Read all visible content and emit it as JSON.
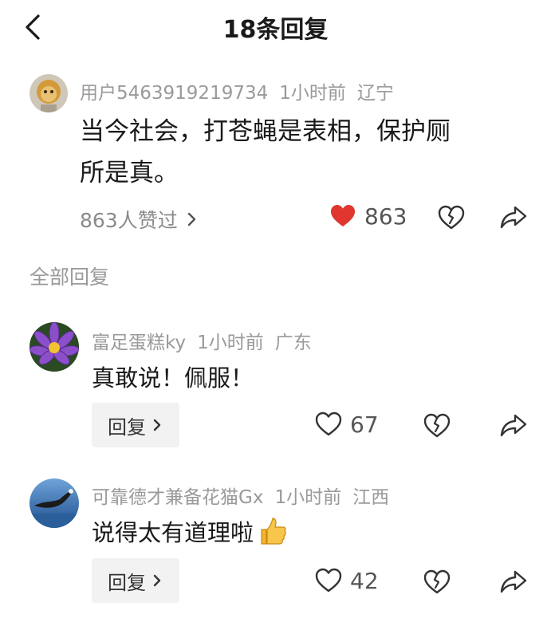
{
  "header": {
    "title": "18条回复"
  },
  "main_comment": {
    "user": "用户5463919219734",
    "time": "1小时前",
    "location": "辽宁",
    "text_line1": "当今社会，打苍蝇是表相，保护厕",
    "text_line2": "所是真。",
    "likers": "863人赞过",
    "like_count": "863",
    "liked": true
  },
  "section_label": "全部回复",
  "replies": [
    {
      "user": "富足蛋糕ky",
      "time": "1小时前",
      "location": "广东",
      "text": "真敢说！佩服！",
      "reply_label": "回复",
      "like_count": "67"
    },
    {
      "user": "可靠德才兼备花猫Gx",
      "time": "1小时前",
      "location": "江西",
      "text": "说得太有道理啦",
      "reply_label": "回复",
      "like_count": "42"
    }
  ],
  "icons": {
    "back": "chevron-left-icon",
    "like_filled": "heart-filled-icon",
    "like": "heart-outline-icon",
    "dislike": "broken-heart-icon",
    "share": "share-arrow-icon",
    "thumbs_up_emoji": "thumbs-up-emoji"
  },
  "colors": {
    "like_red": "#e0362e",
    "meta_gray": "#9a9a9a",
    "text": "#1a1a1a"
  }
}
